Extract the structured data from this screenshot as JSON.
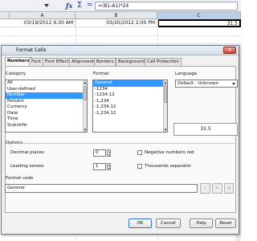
{
  "formula_bar": {
    "formula": "=(B1-A1)*24",
    "fx_icon": "fx-icon",
    "sum_symbol": "Σ",
    "equals_symbol": "="
  },
  "sheet": {
    "columns": [
      "A",
      "B",
      "C"
    ],
    "row1": {
      "a": "03/19/2012 6:30 AM",
      "b": "03/20/2012 2:00 PM",
      "c": "31.5"
    }
  },
  "dialog": {
    "title": "Format Cells",
    "close_symbol": "✕",
    "tabs": [
      "Numbers",
      "Font",
      "Font Effects",
      "Alignment",
      "Borders",
      "Background",
      "Cell Protection"
    ],
    "category": {
      "label": "Category",
      "items": [
        "All",
        "User-defined",
        "Number",
        "Percent",
        "Currency",
        "Date",
        "Time",
        "Scientific"
      ],
      "selected": "Number"
    },
    "format": {
      "label": "Format",
      "items": [
        "General",
        "-1234",
        "-1234.12",
        "-1,234",
        "-1,234.12",
        "-1,234.12"
      ],
      "selected": "General"
    },
    "language": {
      "label": "Language",
      "value": "Default - Unknown"
    },
    "preview_value": "31.5",
    "options": {
      "label": "Options",
      "decimal_places_label": "Decimal places",
      "decimal_places_value": "0",
      "leading_zeroes_label": "Leading zeroes",
      "leading_zeroes_value": "1",
      "negative_red_label": "Negative numbers red",
      "thousands_sep_label": "Thousands separator"
    },
    "format_code": {
      "label": "Format code",
      "value": "General",
      "add_symbol": "✓",
      "comment_symbol": "✎",
      "remove_symbol": "✕"
    },
    "buttons": {
      "ok": "OK",
      "cancel": "Cancel",
      "help": "Help",
      "reset": "Reset"
    }
  },
  "colors": {
    "selection": "#3399ff",
    "titlebar": "#d5dde8",
    "close_button": "#c7412b"
  }
}
